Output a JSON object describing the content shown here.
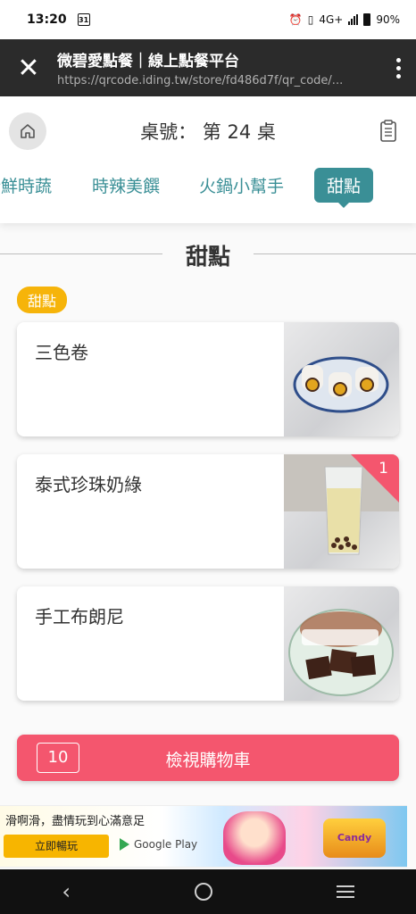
{
  "status": {
    "time": "13:20",
    "calendar_day": "31",
    "network": "4G+",
    "battery": "90%"
  },
  "browser": {
    "title": "微碧愛點餐｜線上點餐平台",
    "url": "https://qrcode.iding.tw/store/fd486d7f/qr_code/...",
    "close_icon": "close-icon",
    "menu_icon": "more-vert-icon"
  },
  "header": {
    "table_label": "桌號：",
    "table_value": "第 24 桌",
    "tabs": [
      {
        "label": "新鮮時蔬",
        "active": false
      },
      {
        "label": "時辣美饌",
        "active": false
      },
      {
        "label": "火鍋小幫手",
        "active": false
      },
      {
        "label": "甜點",
        "active": true
      }
    ]
  },
  "section": {
    "title": "甜點",
    "category_badge": "甜點"
  },
  "items": [
    {
      "name": "三色卷",
      "quantity": null
    },
    {
      "name": "泰式珍珠奶綠",
      "quantity": "1"
    },
    {
      "name": "手工布朗尼",
      "quantity": null
    }
  ],
  "cart": {
    "count": "10",
    "label": "檢視購物車"
  },
  "ad": {
    "text": "滑啊滑，盡情玩到心滿意足",
    "cta": "立即暢玩",
    "store": "Google Play",
    "game": "Candy Crush SAGA"
  },
  "colors": {
    "accent": "#3a8f96",
    "cart": "#f4566e",
    "badge": "#f6b40a"
  }
}
